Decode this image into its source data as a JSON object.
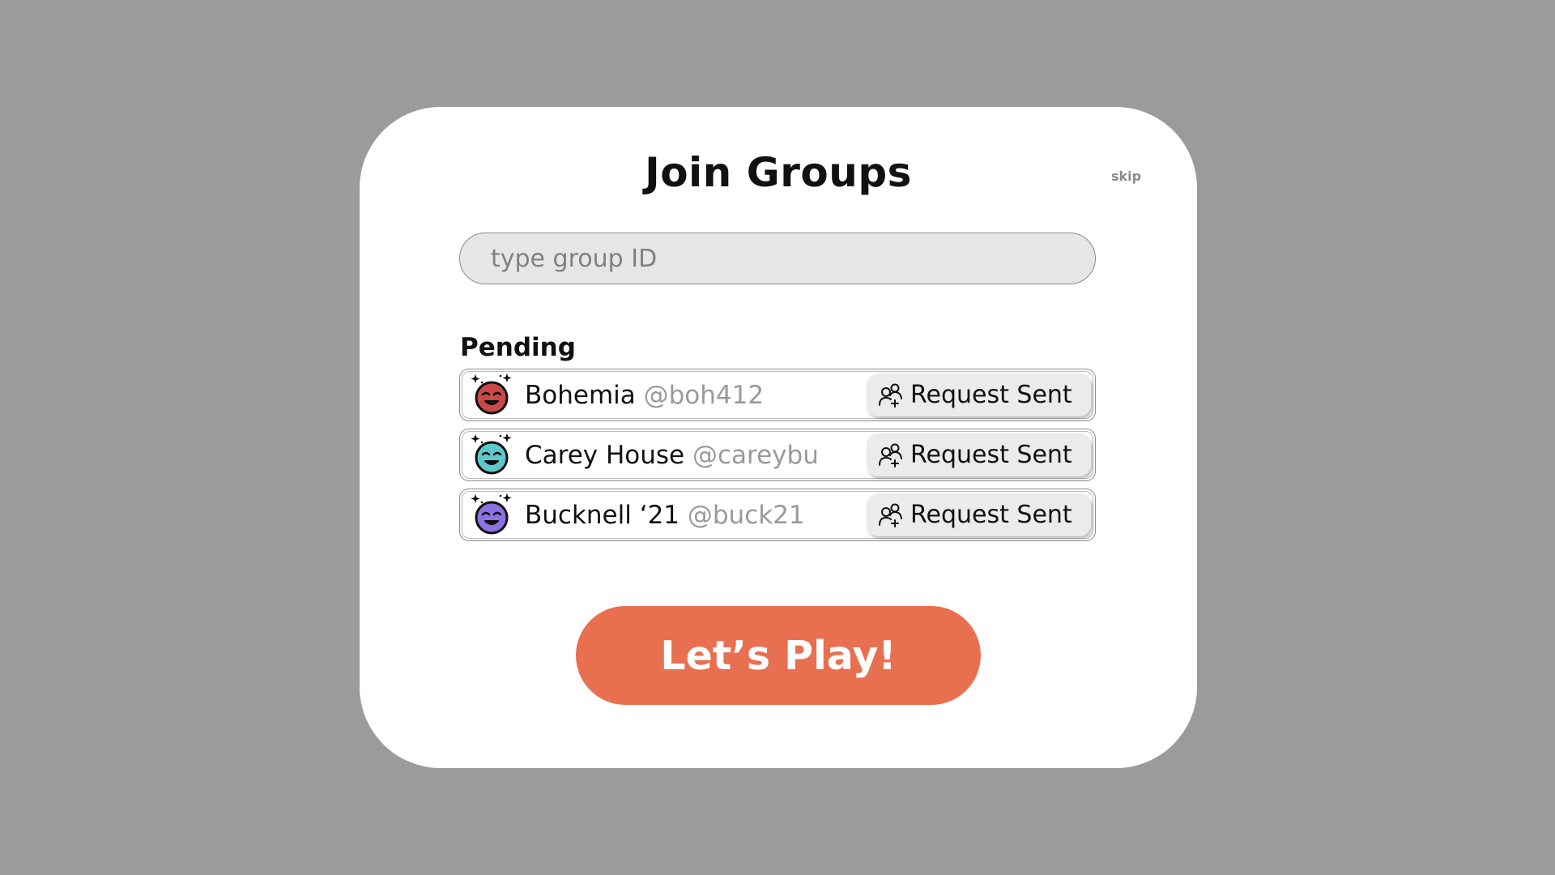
{
  "modal": {
    "title": "Join Groups",
    "skip_label": "skip",
    "search": {
      "placeholder": "type group ID",
      "value": ""
    },
    "pending_label": "Pending",
    "pending": [
      {
        "name": "Bohemia",
        "handle": "@boh412",
        "status": "Request Sent",
        "avatar_color": "#c94a46"
      },
      {
        "name": "Carey House",
        "handle": "@careybu",
        "status": "Request Sent",
        "avatar_color": "#5ec9cd"
      },
      {
        "name": "Bucknell ‘21",
        "handle": "@buck21",
        "status": "Request Sent",
        "avatar_color": "#8a72e2"
      }
    ],
    "play_label": "Let’s Play!"
  },
  "colors": {
    "background": "#9b9b9b",
    "accent": "#e87051",
    "input_bg": "#e6e6e6"
  },
  "icons": {
    "avatar": "sparkle-smiley-icon",
    "request": "add-user-icon"
  }
}
